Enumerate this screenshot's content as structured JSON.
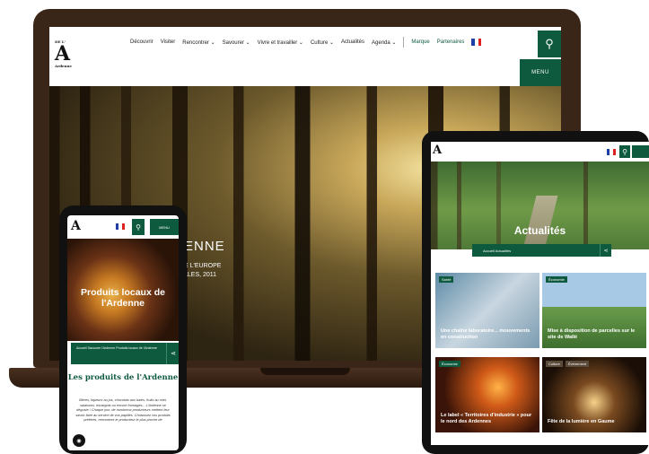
{
  "laptop": {
    "logo_letter": "A",
    "logo_small": "Ardenne",
    "logo_prefix": "DE L'",
    "nav": [
      "Découvrir",
      "Visiter",
      "Rencontrer ⌄",
      "Savourer ⌄",
      "Vivre et travailler ⌄",
      "Culture ⌄",
      "Actualités",
      "Agenda ⌄"
    ],
    "nav_right": [
      "Marque",
      "Partenaires"
    ],
    "menu_label": "MENU",
    "hero_title": "ENNE",
    "hero_sub_1": "E L'EUROPE",
    "hero_sub_2": "LLES, 2011"
  },
  "tablet": {
    "logo_letter": "A",
    "hero_title": "Actualités",
    "breadcrumb": "Accueil   Actualités",
    "cards": [
      {
        "tag": "Santé",
        "caption": "Une chaîne laboratoire... mouvements en construction"
      },
      {
        "tag": "Économie",
        "caption": "Mise à disposition de parcelles sur le site de Wallé"
      },
      {
        "tag": "Économie",
        "caption": "Le label « Territoires d'industrie » pour le nord des Ardennes"
      },
      {
        "tag": "Culture",
        "tag2": "Événement",
        "caption": "Fête de la lumière en Gaume"
      }
    ]
  },
  "phone": {
    "logo_letter": "A",
    "menu_label": "MENU",
    "hero_title": "Produits locaux de l'Ardenne",
    "breadcrumb": "Accueil   Savourer l'Ardenne   Produits locaux de l'Ardenne",
    "heading": "Les produits de l'Ardenne",
    "paragraph": "Bières, liqueurs au jus, chocolats aux baies, fruits au miel, salaisons, escargots ou encore fromages... L'Ardenne se déguste ! Chaque jour, de nombreux producteurs mettent leur savoir-faire au service de vos papilles. Choisissez vos produits préférés, rencontrez le producteur le plus proche de"
  },
  "colors": {
    "brand_green": "#0d5a3f",
    "device_brown": "#3a2618"
  },
  "icons": [
    "search-icon",
    "share-icon",
    "flag-fr-icon",
    "accessibility-icon"
  ]
}
